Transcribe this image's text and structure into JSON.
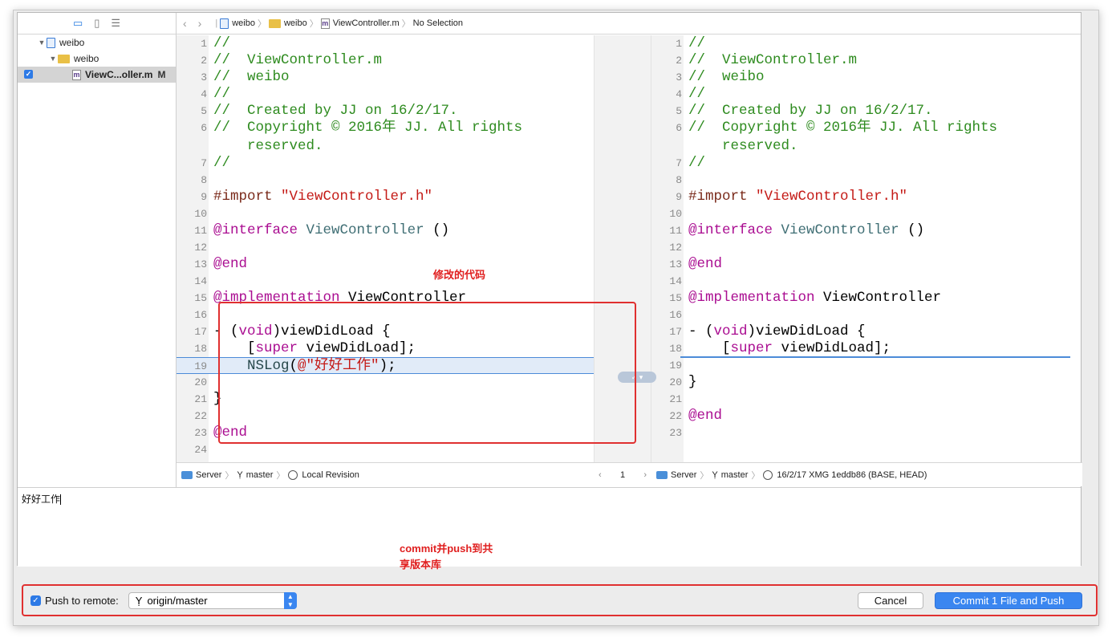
{
  "navigator": {
    "items": [
      {
        "label": "weibo",
        "kind": "project-icon"
      },
      {
        "label": "weibo",
        "kind": "folder-icon"
      },
      {
        "label": "ViewC...oller.m",
        "kind": "objc-file-icon",
        "status": "M",
        "checked": true
      }
    ]
  },
  "jumpbar": {
    "crumbs": [
      "weibo",
      "weibo",
      "ViewController.m",
      "No Selection"
    ]
  },
  "left_pane": {
    "lines": [
      {
        "n": "1",
        "text": "//"
      },
      {
        "n": "2",
        "text": "//  ViewController.m"
      },
      {
        "n": "3",
        "text": "//  weibo"
      },
      {
        "n": "4",
        "text": "//"
      },
      {
        "n": "5",
        "text": "//  Created by JJ on 16/2/17."
      },
      {
        "n": "6",
        "text": "//  Copyright © 2016年 JJ. All rights"
      },
      {
        "n": "",
        "text": "    reserved."
      },
      {
        "n": "7",
        "text": "//"
      },
      {
        "n": "8",
        "text": ""
      },
      {
        "n": "9",
        "text": "#import \"ViewController.h\""
      },
      {
        "n": "10",
        "text": ""
      },
      {
        "n": "11",
        "text": "@interface ViewController ()"
      },
      {
        "n": "12",
        "text": ""
      },
      {
        "n": "13",
        "text": "@end"
      },
      {
        "n": "14",
        "text": ""
      },
      {
        "n": "15",
        "text": "@implementation ViewController"
      },
      {
        "n": "16",
        "text": ""
      },
      {
        "n": "17",
        "text": "- (void)viewDidLoad {"
      },
      {
        "n": "18",
        "text": "    [super viewDidLoad];"
      },
      {
        "n": "19",
        "text": "    NSLog(@\"好好工作\");"
      },
      {
        "n": "20",
        "text": ""
      },
      {
        "n": "21",
        "text": "}"
      },
      {
        "n": "22",
        "text": ""
      },
      {
        "n": "23",
        "text": "@end"
      },
      {
        "n": "24",
        "text": ""
      }
    ]
  },
  "right_pane": {
    "lines": [
      {
        "n": "1",
        "text": "//"
      },
      {
        "n": "2",
        "text": "//  ViewController.m"
      },
      {
        "n": "3",
        "text": "//  weibo"
      },
      {
        "n": "4",
        "text": "//"
      },
      {
        "n": "5",
        "text": "//  Created by JJ on 16/2/17."
      },
      {
        "n": "6",
        "text": "//  Copyright © 2016年 JJ. All rights"
      },
      {
        "n": "",
        "text": "    reserved."
      },
      {
        "n": "7",
        "text": "//"
      },
      {
        "n": "8",
        "text": ""
      },
      {
        "n": "9",
        "text": "#import \"ViewController.h\""
      },
      {
        "n": "10",
        "text": ""
      },
      {
        "n": "11",
        "text": "@interface ViewController ()"
      },
      {
        "n": "12",
        "text": ""
      },
      {
        "n": "13",
        "text": "@end"
      },
      {
        "n": "14",
        "text": ""
      },
      {
        "n": "15",
        "text": "@implementation ViewController"
      },
      {
        "n": "16",
        "text": ""
      },
      {
        "n": "17",
        "text": "- (void)viewDidLoad {"
      },
      {
        "n": "18",
        "text": "    [super viewDidLoad];"
      },
      {
        "n": "19",
        "text": ""
      },
      {
        "n": "20",
        "text": "}"
      },
      {
        "n": "21",
        "text": ""
      },
      {
        "n": "22",
        "text": "@end"
      },
      {
        "n": "23",
        "text": ""
      }
    ]
  },
  "status_left": {
    "server": "Server",
    "branch": "master",
    "revision": "Local Revision"
  },
  "status_mid": {
    "page": "1"
  },
  "status_right": {
    "server": "Server",
    "branch": "master",
    "revision": "16/2/17  XMG  1eddb86 (BASE, HEAD)"
  },
  "commit_message": "好好工作",
  "annotations": {
    "modified_code": "修改的代码",
    "commit_push_line1": "commit并push到共",
    "commit_push_line2": "享版本库"
  },
  "footer": {
    "push_label": "Push to remote:",
    "push_checked": true,
    "remote": "origin/master",
    "cancel": "Cancel",
    "commit": "Commit 1 File and Push"
  },
  "colors": {
    "accent": "#3a86f0",
    "annotation": "#e03030",
    "comment": "#2e8b1f",
    "keyword": "#aa0d91",
    "string": "#c41a16"
  }
}
